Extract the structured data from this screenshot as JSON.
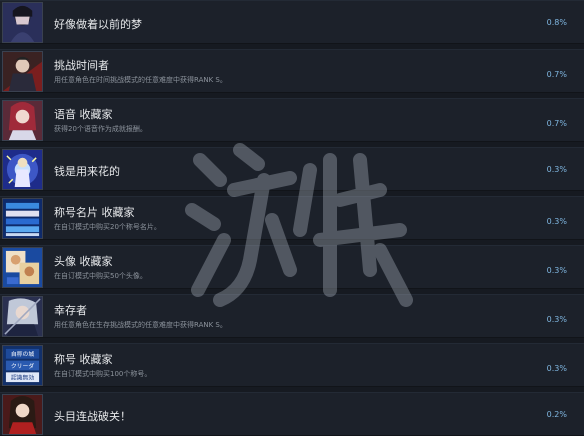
{
  "achievements": [
    {
      "title": "好像做着以前的梦",
      "description": "",
      "percent": "0.8%",
      "icon": "dark-haired-swordsman-icon",
      "tint": "#3a3f78"
    },
    {
      "title": "挑战时间者",
      "description": "用任意角色在时间挑战模式的任意难度中获得RANK S。",
      "percent": "0.7%",
      "icon": "fighter-red-scarf-icon",
      "tint": "#7a2a2a"
    },
    {
      "title": "语音 收藏家",
      "description": "获得20个语音作为成就报酬。",
      "percent": "0.7%",
      "icon": "red-haired-girl-icon",
      "tint": "#8a3a48"
    },
    {
      "title": "钱是用来花的",
      "description": "",
      "percent": "0.3%",
      "icon": "sparkle-girl-icon",
      "tint": "#2e3fa8"
    },
    {
      "title": "称号名片 收藏家",
      "description": "在自订模式中购买20个称号名片。",
      "percent": "0.3%",
      "icon": "name-cards-icon",
      "tint": "#1e5ab0"
    },
    {
      "title": "头像 收藏家",
      "description": "在自订模式中购买50个头像。",
      "percent": "0.3%",
      "icon": "avatar-cards-icon",
      "tint": "#2a5aa8"
    },
    {
      "title": "幸存者",
      "description": "用任意角色在生存挑战模式的任意难度中获得RANK S。",
      "percent": "0.3%",
      "icon": "survivor-swordsman-icon",
      "tint": "#3a4a7a"
    },
    {
      "title": "称号 收藏家",
      "description": "在自订模式中购买100个称号。",
      "percent": "0.3%",
      "icon": "title-badges-icon",
      "tint": "#1f3f78",
      "badge_lines": [
        "自称の城",
        "クリーダ",
        "認識無効"
      ]
    },
    {
      "title": "头目连战破关！",
      "description": "",
      "percent": "0.2%",
      "icon": "boss-rush-girl-icon",
      "tint": "#6a2a2a"
    }
  ],
  "watermark_text": "游侠网"
}
